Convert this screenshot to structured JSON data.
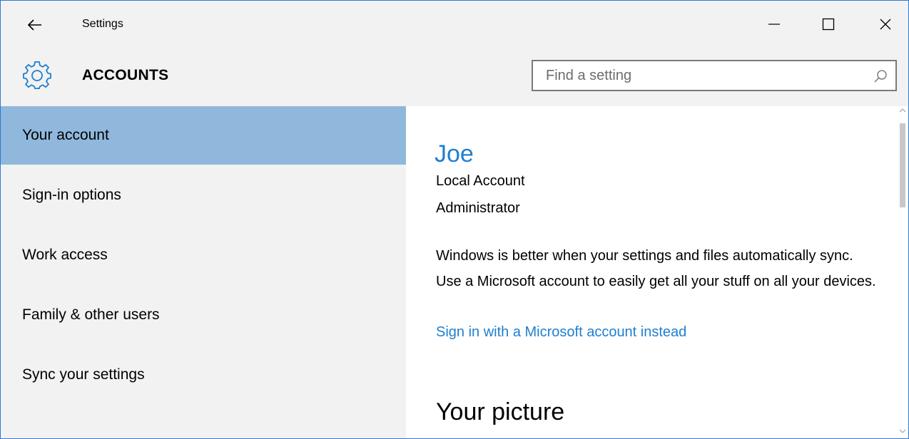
{
  "window": {
    "title": "Settings",
    "accent_color": "#2b79d0"
  },
  "header": {
    "section_title": "ACCOUNTS",
    "search": {
      "placeholder": "Find a setting",
      "value": ""
    }
  },
  "sidebar": {
    "items": [
      {
        "label": "Your account",
        "active": true
      },
      {
        "label": "Sign-in options",
        "active": false
      },
      {
        "label": "Work access",
        "active": false
      },
      {
        "label": "Family & other users",
        "active": false
      },
      {
        "label": "Sync your settings",
        "active": false
      }
    ],
    "active_color": "#8fb8dc"
  },
  "account": {
    "name": "Joe",
    "type": "Local Account",
    "role": "Administrator",
    "sync_message": "Windows is better when your settings and files automatically sync. Use a Microsoft account to easily get all your stuff on all your devices.",
    "link_text": "Sign in with a Microsoft account instead",
    "link_color": "#1f7fd0"
  },
  "picture": {
    "heading": "Your picture"
  }
}
